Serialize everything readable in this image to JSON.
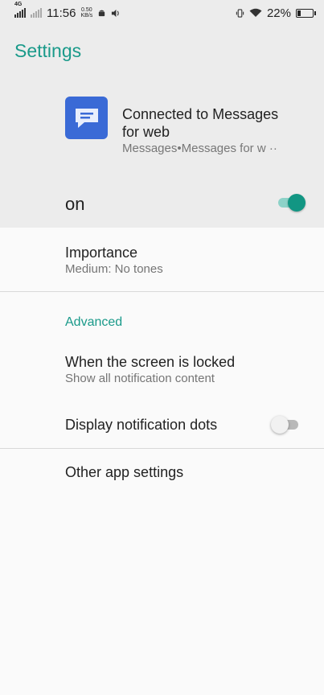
{
  "status_bar": {
    "network": "4G",
    "time": "11:56",
    "speed_value": "0.50",
    "speed_unit": "KB/s",
    "battery_percent": "22%",
    "battery_level": 0.22,
    "icons": [
      "signal-icon",
      "signal-dim-icon",
      "android-icon",
      "sound-icon",
      "vibrate-icon",
      "wifi-icon",
      "battery-icon"
    ]
  },
  "app_bar": {
    "title": "Settings"
  },
  "channel": {
    "title": "Connected to Messages for web",
    "subtitle": "Messages•Messages for w ··",
    "app_icon": "messages-app-icon"
  },
  "master_toggle": {
    "label": "on",
    "state": true
  },
  "settings": {
    "importance": {
      "title": "Importance",
      "value": "Medium: No tones"
    },
    "advanced_header": "Advanced",
    "lock_screen": {
      "title": "When the screen is locked",
      "value": "Show all notification content"
    },
    "dots": {
      "title": "Display notification dots",
      "state": false
    },
    "other": {
      "title": "Other app settings"
    }
  },
  "colors": {
    "accent": "#1a9a8a",
    "toggle_on": "#129683",
    "app_icon_bg": "#3a6ad6",
    "header_bg": "#ececec",
    "body_bg": "#fafafa"
  }
}
